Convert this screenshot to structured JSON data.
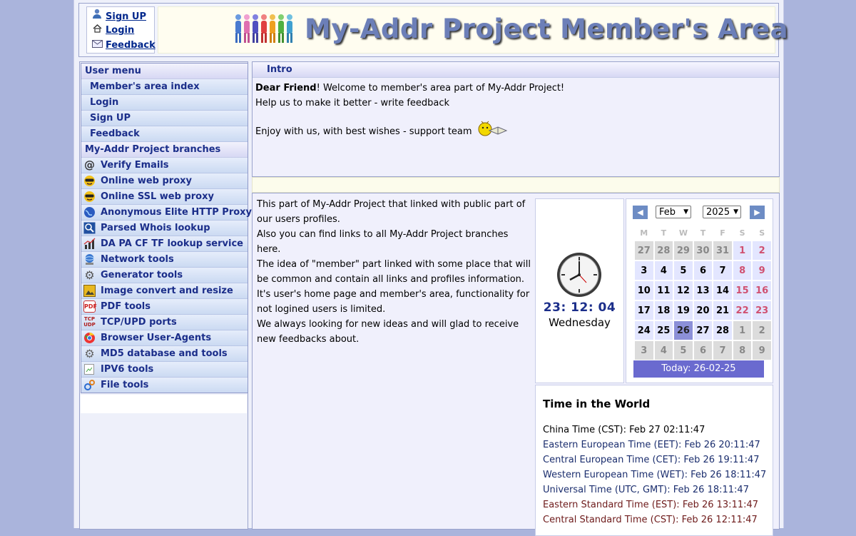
{
  "header": {
    "links": [
      {
        "label": "Sign UP",
        "icon": "user-icon"
      },
      {
        "label": "Login",
        "icon": "home-icon"
      },
      {
        "label": "Feedback",
        "icon": "mail-icon"
      }
    ],
    "banner_title": "My-Addr Project Member's Area"
  },
  "sidebar": {
    "user_menu_title": "User menu",
    "user_menu": [
      "Member's area index",
      "Login",
      "Sign UP",
      "Feedback"
    ],
    "branches_title": "My-Addr Project branches",
    "branches": [
      {
        "label": "Verify Emails",
        "icon": "at-icon"
      },
      {
        "label": "Online web proxy",
        "icon": "sunglasses-icon"
      },
      {
        "label": "Online SSL web proxy",
        "icon": "sunglasses-icon"
      },
      {
        "label": "Anonymous Elite HTTP Proxy",
        "icon": "globe-icon"
      },
      {
        "label": "Parsed Whois lookup",
        "icon": "magnifier-icon"
      },
      {
        "label": "DA PA CF TF lookup service",
        "icon": "chart-icon"
      },
      {
        "label": "Network tools",
        "icon": "network-icon"
      },
      {
        "label": "Generator tools",
        "icon": "gear-icon"
      },
      {
        "label": "Image convert and resize",
        "icon": "image-icon"
      },
      {
        "label": "PDF tools",
        "icon": "pdf-icon"
      },
      {
        "label": "TCP/UPD ports",
        "icon": "tcp-icon"
      },
      {
        "label": "Browser User-Agents",
        "icon": "browser-icon"
      },
      {
        "label": "MD5 database and tools",
        "icon": "database-icon"
      },
      {
        "label": "IPV6 tools",
        "icon": "broken-image-icon"
      },
      {
        "label": "File tools",
        "icon": "file-tools-icon"
      }
    ]
  },
  "intro": {
    "title": "Intro",
    "greeting_bold": "Dear Friend",
    "greeting_rest": "! Welcome to member's area part of My-Addr Project!",
    "line2": "Help us to make it better - write feedback",
    "line3": "Enjoy with us, with best wishes - support team"
  },
  "content": {
    "paragraph": "This part of My-Addr Project that linked with public part of our users profiles.\nAlso you can find links to all My-Addr Project branches here.\nThe idea of \"member\" part linked with some place that will be common and contain all links and profiles information.\nIt's user's home page and member's area, functionality for not logined users is limited.\nWe always looking for new ideas and will glad to receive new feedbacks about."
  },
  "clock": {
    "time": "23: 12: 04",
    "day": "Wednesday"
  },
  "calendar": {
    "month": "Feb",
    "year": "2025",
    "weekdays": [
      "M",
      "T",
      "W",
      "T",
      "F",
      "S",
      "S"
    ],
    "weeks": [
      [
        "27",
        "28",
        "29",
        "30",
        "31",
        "1",
        "2"
      ],
      [
        "3",
        "4",
        "5",
        "6",
        "7",
        "8",
        "9"
      ],
      [
        "10",
        "11",
        "12",
        "13",
        "14",
        "15",
        "16"
      ],
      [
        "17",
        "18",
        "19",
        "20",
        "21",
        "22",
        "23"
      ],
      [
        "24",
        "25",
        "26",
        "27",
        "28",
        "1",
        "2"
      ],
      [
        "3",
        "4",
        "5",
        "6",
        "7",
        "8",
        "9"
      ]
    ],
    "today_label": "Today: 26-02-25"
  },
  "world_time": {
    "title": "Time in the World",
    "zones": [
      {
        "label": "China Time (CST): Feb 27 02:11:47",
        "color": "#000000"
      },
      {
        "label": "Eastern European Time (EET): Feb 26 20:11:47",
        "color": "#1b2e6e"
      },
      {
        "label": "Central European Time (CET): Feb 26 19:11:47",
        "color": "#1b2e6e"
      },
      {
        "label": "Western European Time (WET): Feb 26 18:11:47",
        "color": "#1b2e6e"
      },
      {
        "label": "Universal Time (UTC, GMT): Feb 26 18:11:47",
        "color": "#1b2e6e"
      },
      {
        "label": "Eastern Standard Time (EST): Feb 26 13:11:47",
        "color": "#6e1b1b"
      },
      {
        "label": "Central Standard Time (CST): Feb 26 12:11:47",
        "color": "#6e1b1b"
      }
    ]
  },
  "colors": {
    "background": "#aab4dc",
    "menu_text": "#1b2e8a",
    "today_bar": "#6a6acf"
  }
}
